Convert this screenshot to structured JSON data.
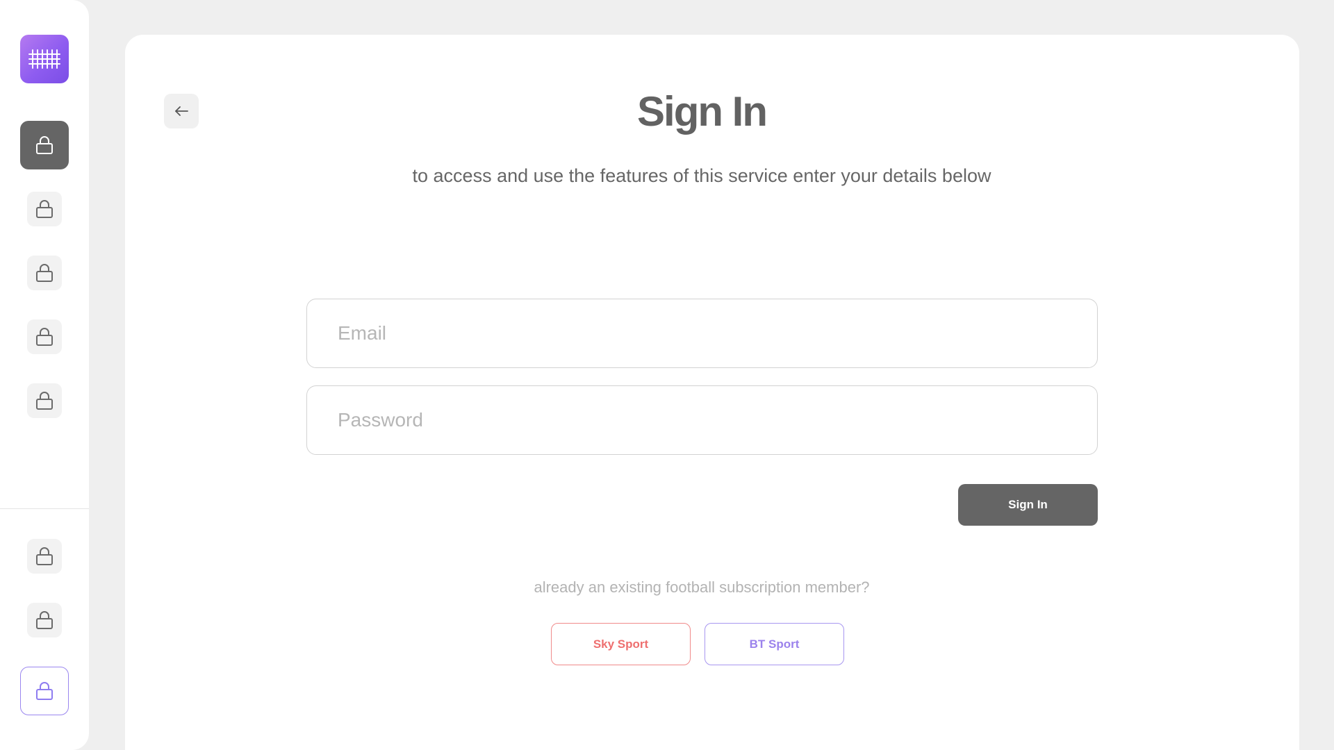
{
  "sidebar": {
    "logo_icon": "grid-pattern-icon",
    "items": [
      {
        "icon": "lock-icon",
        "state": "active"
      },
      {
        "icon": "lock-icon",
        "state": "default"
      },
      {
        "icon": "lock-icon",
        "state": "default"
      },
      {
        "icon": "lock-icon",
        "state": "default"
      },
      {
        "icon": "lock-icon",
        "state": "default"
      }
    ],
    "bottom_items": [
      {
        "icon": "lock-icon",
        "state": "default"
      },
      {
        "icon": "lock-icon",
        "state": "default"
      },
      {
        "icon": "lock-icon",
        "state": "outlined"
      }
    ]
  },
  "header": {
    "back_icon": "arrow-left-icon",
    "title": "Sign In",
    "subtitle": "to access and use the features of this service enter your details below"
  },
  "form": {
    "email_placeholder": "Email",
    "email_value": "",
    "password_placeholder": "Password",
    "password_value": "",
    "submit_label": "Sign In"
  },
  "providers": {
    "prompt": "already an existing football subscription member?",
    "sky_label": "Sky Sport",
    "bt_label": "BT Sport"
  },
  "colors": {
    "background": "#efefef",
    "surface": "#ffffff",
    "dark_button": "#656565",
    "accent_purple": "#8e5cf0",
    "sky_red": "#ee6f6f",
    "bt_purple": "#9b82ec"
  }
}
